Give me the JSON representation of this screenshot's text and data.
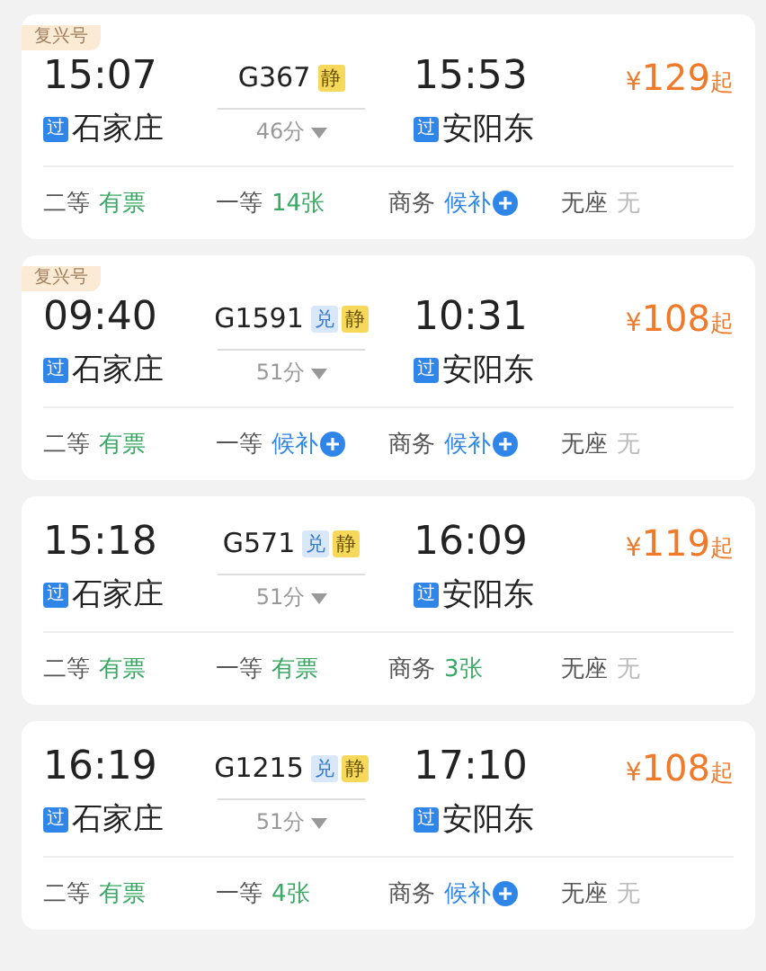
{
  "trains": [
    {
      "tag": "复兴号",
      "depart": "15:07",
      "number": "G367",
      "badges": [
        {
          "kind": "quiet",
          "text": "静"
        }
      ],
      "arrive": "15:53",
      "price_symbol": "¥",
      "price": "129",
      "price_suffix": "起",
      "from_mark": "过",
      "from": "石家庄",
      "duration": "46分",
      "to_mark": "过",
      "to": "安阳东",
      "seats": [
        {
          "name": "二等",
          "kind": "available",
          "status": "有票"
        },
        {
          "name": "一等",
          "kind": "available",
          "status": "14张"
        },
        {
          "name": "商务",
          "kind": "waitlist",
          "status": "候补"
        },
        {
          "name": "无座",
          "kind": "none",
          "status": "无"
        }
      ]
    },
    {
      "tag": "复兴号",
      "depart": "09:40",
      "number": "G1591",
      "badges": [
        {
          "kind": "exchange",
          "text": "兑"
        },
        {
          "kind": "quiet",
          "text": "静"
        }
      ],
      "arrive": "10:31",
      "price_symbol": "¥",
      "price": "108",
      "price_suffix": "起",
      "from_mark": "过",
      "from": "石家庄",
      "duration": "51分",
      "to_mark": "过",
      "to": "安阳东",
      "seats": [
        {
          "name": "二等",
          "kind": "available",
          "status": "有票"
        },
        {
          "name": "一等",
          "kind": "waitlist",
          "status": "候补"
        },
        {
          "name": "商务",
          "kind": "waitlist",
          "status": "候补"
        },
        {
          "name": "无座",
          "kind": "none",
          "status": "无"
        }
      ]
    },
    {
      "depart": "15:18",
      "number": "G571",
      "badges": [
        {
          "kind": "exchange",
          "text": "兑"
        },
        {
          "kind": "quiet",
          "text": "静"
        }
      ],
      "arrive": "16:09",
      "price_symbol": "¥",
      "price": "119",
      "price_suffix": "起",
      "from_mark": "过",
      "from": "石家庄",
      "duration": "51分",
      "to_mark": "过",
      "to": "安阳东",
      "seats": [
        {
          "name": "二等",
          "kind": "available",
          "status": "有票"
        },
        {
          "name": "一等",
          "kind": "available",
          "status": "有票"
        },
        {
          "name": "商务",
          "kind": "available",
          "status": "3张"
        },
        {
          "name": "无座",
          "kind": "none",
          "status": "无"
        }
      ]
    },
    {
      "depart": "16:19",
      "number": "G1215",
      "badges": [
        {
          "kind": "exchange",
          "text": "兑"
        },
        {
          "kind": "quiet",
          "text": "静"
        }
      ],
      "arrive": "17:10",
      "price_symbol": "¥",
      "price": "108",
      "price_suffix": "起",
      "from_mark": "过",
      "from": "石家庄",
      "duration": "51分",
      "to_mark": "过",
      "to": "安阳东",
      "seats": [
        {
          "name": "二等",
          "kind": "available",
          "status": "有票"
        },
        {
          "name": "一等",
          "kind": "available",
          "status": "4张"
        },
        {
          "name": "商务",
          "kind": "waitlist",
          "status": "候补"
        },
        {
          "name": "无座",
          "kind": "none",
          "status": "无"
        }
      ]
    }
  ]
}
